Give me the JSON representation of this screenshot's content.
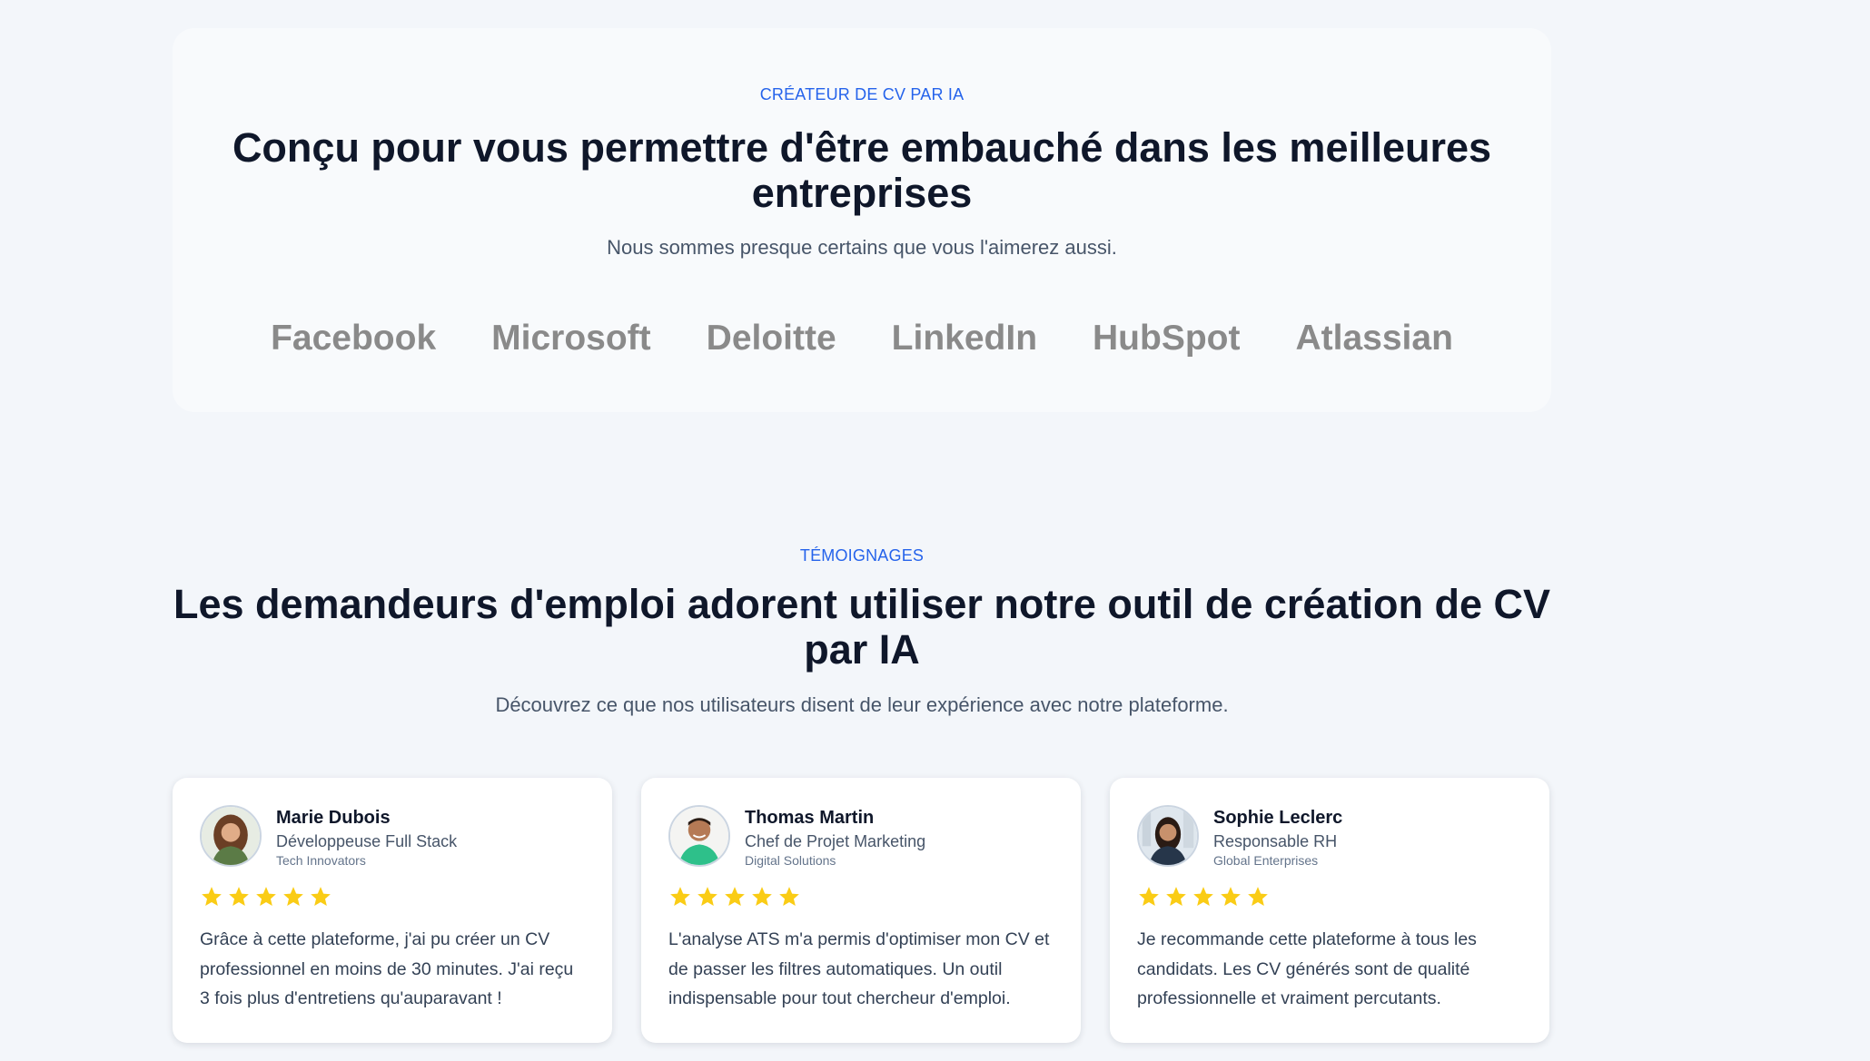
{
  "companies_section": {
    "eyebrow": "CRÉATEUR DE CV PAR IA",
    "title_line1": "Conçu pour vous permettre d'être embauché dans les meilleures",
    "title_line2": "entreprises",
    "subtitle": "Nous sommes presque certains que vous l'aimerez aussi.",
    "logos": [
      "Facebook",
      "Microsoft",
      "Deloitte",
      "LinkedIn",
      "HubSpot",
      "Atlassian"
    ]
  },
  "testimonials_section": {
    "eyebrow": "TÉMOIGNAGES",
    "title_line1": "Les demandeurs d'emploi adorent utiliser notre outil de création de CV",
    "title_line2": "par IA",
    "subtitle": "Découvrez ce que nos utilisateurs disent de leur expérience avec notre plateforme.",
    "items": [
      {
        "name": "Marie Dubois",
        "role": "Développeuse Full Stack",
        "company": "Tech Innovators",
        "rating": 5,
        "quote": "Grâce à cette plateforme, j'ai pu créer un CV professionnel en moins de 30 minutes. J'ai reçu 3 fois plus d'entretiens qu'auparavant !"
      },
      {
        "name": "Thomas Martin",
        "role": "Chef de Projet Marketing",
        "company": "Digital Solutions",
        "rating": 5,
        "quote": "L'analyse ATS m'a permis d'optimiser mon CV et de passer les filtres automatiques. Un outil indispensable pour tout chercheur d'emploi."
      },
      {
        "name": "Sophie Leclerc",
        "role": "Responsable RH",
        "company": "Global Enterprises",
        "rating": 5,
        "quote": "Je recommande cette plateforme à tous les candidats. Les CV générés sont de qualité professionnelle et vraiment percutants."
      }
    ]
  },
  "colors": {
    "accent": "#2563eb",
    "heading": "#0f172a",
    "logo_gray": "#8a8a8a",
    "star": "#facc15"
  },
  "icons": {
    "rating": "star-icon"
  }
}
